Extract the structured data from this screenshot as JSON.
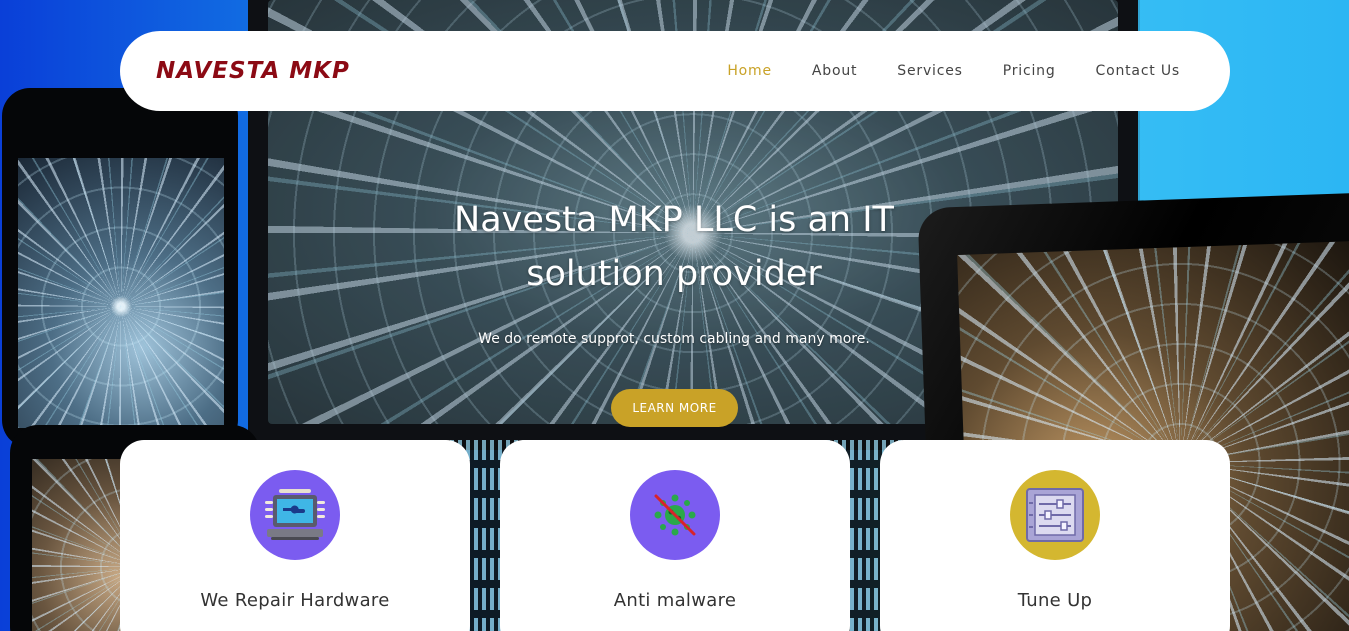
{
  "header": {
    "brand": "NAVESTA MKP",
    "nav": [
      {
        "label": "Home",
        "active": true
      },
      {
        "label": "About",
        "active": false
      },
      {
        "label": "Services",
        "active": false
      },
      {
        "label": "Pricing",
        "active": false
      },
      {
        "label": "Contact Us",
        "active": false
      }
    ]
  },
  "hero": {
    "title": "Navesta MKP LLC is an IT solution provider",
    "subtitle": "We do remote supprot, custom cabling and many more.",
    "cta_label": "LEARN MORE"
  },
  "services": [
    {
      "title": "We Repair Hardware",
      "icon": "laptop-repair-icon",
      "icon_bg": "#7b5cf0"
    },
    {
      "title": "Anti malware",
      "icon": "virus-blocked-icon",
      "icon_bg": "#7b5cf0"
    },
    {
      "title": "Tune Up",
      "icon": "sliders-panel-icon",
      "icon_bg": "#d4b730"
    }
  ],
  "colors": {
    "brand": "#8c0a14",
    "accent": "#c9a227",
    "card_icon_purple": "#7b5cf0",
    "card_icon_gold": "#d4b730"
  }
}
